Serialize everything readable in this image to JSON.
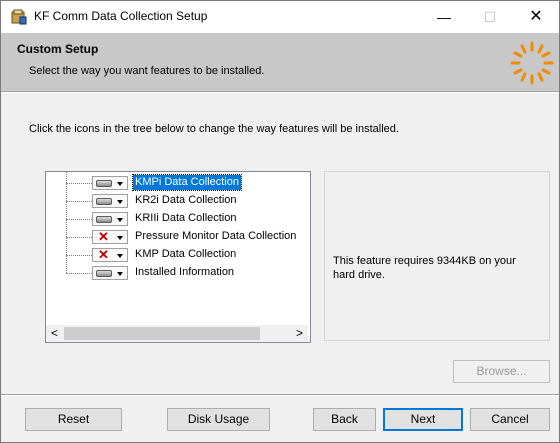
{
  "window": {
    "title": "KF Comm Data Collection Setup",
    "minimize": "—",
    "maximize": "☐",
    "close": "✕"
  },
  "banner": {
    "title": "Custom Setup",
    "subtitle": "Select the way you want features to be installed."
  },
  "instruction": "Click the icons in the tree below to change the way features will be installed.",
  "tree": {
    "items": [
      {
        "label": "KMPi Data Collection",
        "state": "local-drive",
        "selected": true
      },
      {
        "label": "KR2i Data Collection",
        "state": "local-drive",
        "selected": false
      },
      {
        "label": "KRIIi Data Collection",
        "state": "local-drive",
        "selected": false
      },
      {
        "label": "Pressure Monitor Data Collection",
        "state": "unavailable",
        "selected": false
      },
      {
        "label": "KMP Data Collection",
        "state": "unavailable",
        "selected": false
      },
      {
        "label": "Installed Information",
        "state": "local-drive",
        "selected": false
      }
    ],
    "scroll_left": "<",
    "scroll_right": ">"
  },
  "description": "This feature requires 9344KB on your hard drive.",
  "buttons": {
    "browse": "Browse...",
    "reset": "Reset",
    "disk_usage": "Disk Usage",
    "back": "Back",
    "next": "Next",
    "cancel": "Cancel"
  }
}
